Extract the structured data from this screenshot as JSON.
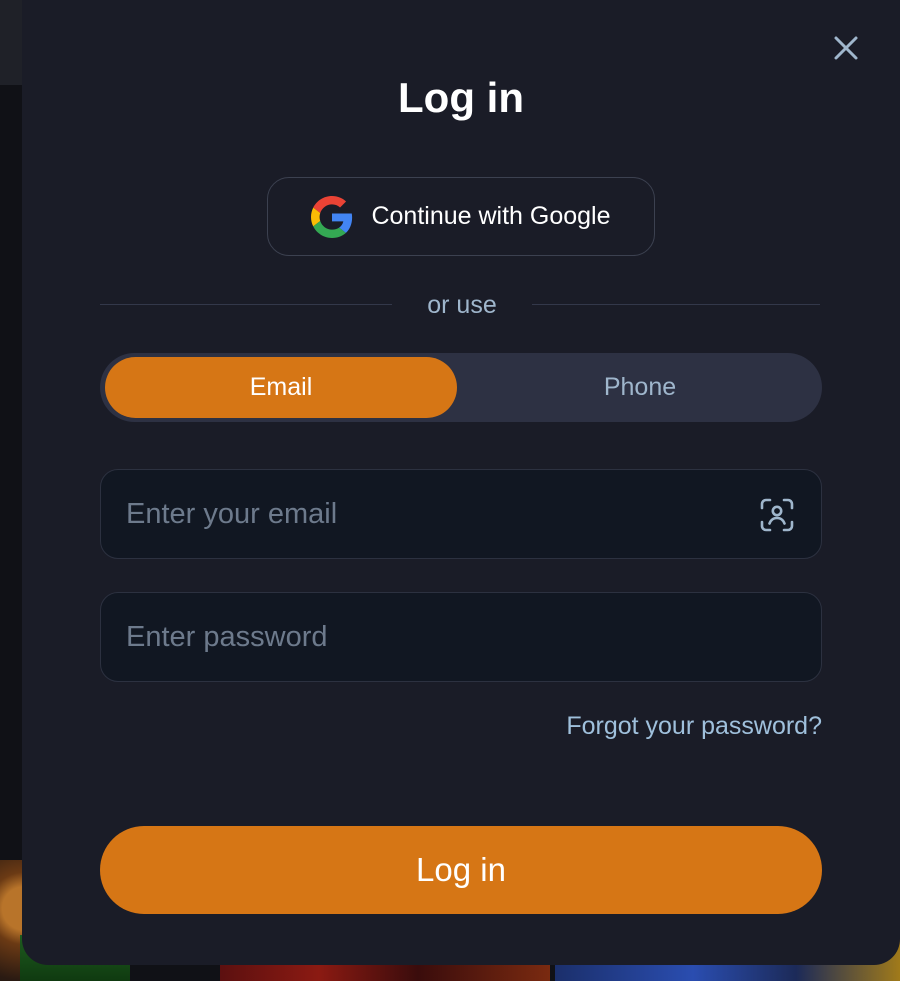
{
  "modal": {
    "title": "Log in",
    "google_button_label": "Continue with Google",
    "divider_text": "or use",
    "tabs": [
      {
        "label": "Email",
        "active": true
      },
      {
        "label": "Phone",
        "active": false
      }
    ],
    "email_field": {
      "placeholder": "Enter your email",
      "value": ""
    },
    "password_field": {
      "placeholder": "Enter password",
      "value": ""
    },
    "forgot_link": "Forgot your password?",
    "submit_label": "Log in"
  },
  "colors": {
    "accent": "#d67615",
    "modal_bg": "#1a1c27",
    "muted_text": "#9fb6cc"
  },
  "icons": [
    "close-icon",
    "google-icon",
    "face-scan-icon"
  ]
}
